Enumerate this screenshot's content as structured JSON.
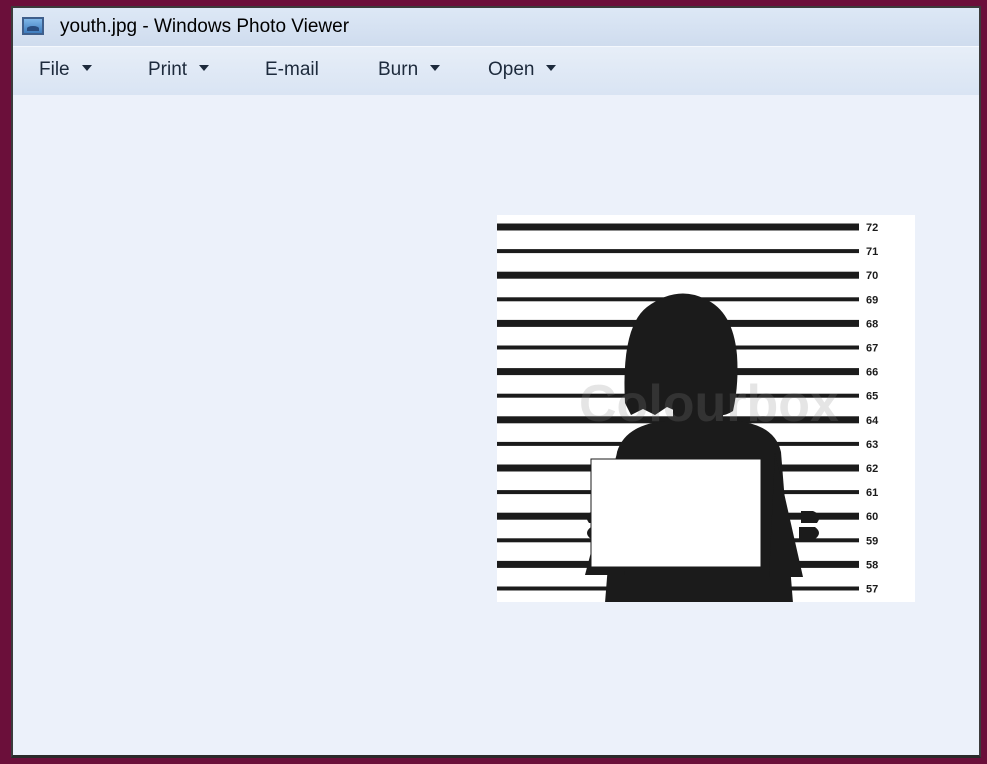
{
  "window": {
    "title": "youth.jpg - Windows Photo Viewer"
  },
  "menu": {
    "file": "File",
    "print": "Print",
    "email": "E-mail",
    "burn": "Burn",
    "open": "Open"
  },
  "photo": {
    "watermark": "Colourbox",
    "height_labels": [
      "72",
      "71",
      "70",
      "69",
      "68",
      "67",
      "66",
      "65",
      "64",
      "63",
      "62",
      "61",
      "60",
      "59",
      "58",
      "57"
    ]
  },
  "colors": {
    "frame": "#6b0f3a",
    "viewer_background": "#ecf1fa"
  },
  "icons": {
    "app": "photo-viewer-icon",
    "dropdown": "dropdown-caret-icon"
  }
}
